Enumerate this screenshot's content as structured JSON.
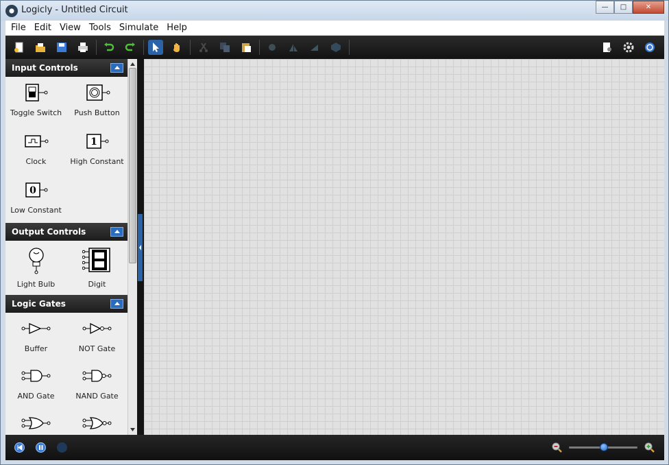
{
  "window": {
    "title": "Logicly - Untitled Circuit"
  },
  "menu": [
    "File",
    "Edit",
    "View",
    "Tools",
    "Simulate",
    "Help"
  ],
  "toolbar": {
    "buttons": [
      "new-icon",
      "open-icon",
      "save-icon",
      "print-icon",
      "undo-icon",
      "redo-icon",
      "select-tool-icon",
      "pan-tool-icon",
      "cut-icon",
      "copy-icon",
      "paste-icon",
      "rotate-icon",
      "flip-horizontal-icon",
      "flip-vertical-icon",
      "group-icon",
      "export-icon",
      "settings-icon",
      "help-icon"
    ],
    "active": "select-tool-icon"
  },
  "sidebar": {
    "categories": [
      {
        "name": "Input Controls",
        "items": [
          "Toggle Switch",
          "Push Button",
          "Clock",
          "High Constant",
          "Low Constant"
        ]
      },
      {
        "name": "Output Controls",
        "items": [
          "Light Bulb",
          "Digit"
        ]
      },
      {
        "name": "Logic Gates",
        "items": [
          "Buffer",
          "NOT Gate",
          "AND Gate",
          "NAND Gate"
        ]
      }
    ],
    "constants": {
      "high": "1",
      "low": "0"
    }
  },
  "statusbar": {
    "zoom_level_fraction": 0.5
  },
  "colors": {
    "accent": "#2a63a8",
    "toolbar": "#1c1c1c",
    "canvas": "#e1e1e1",
    "grid": "#cfcfcf"
  }
}
